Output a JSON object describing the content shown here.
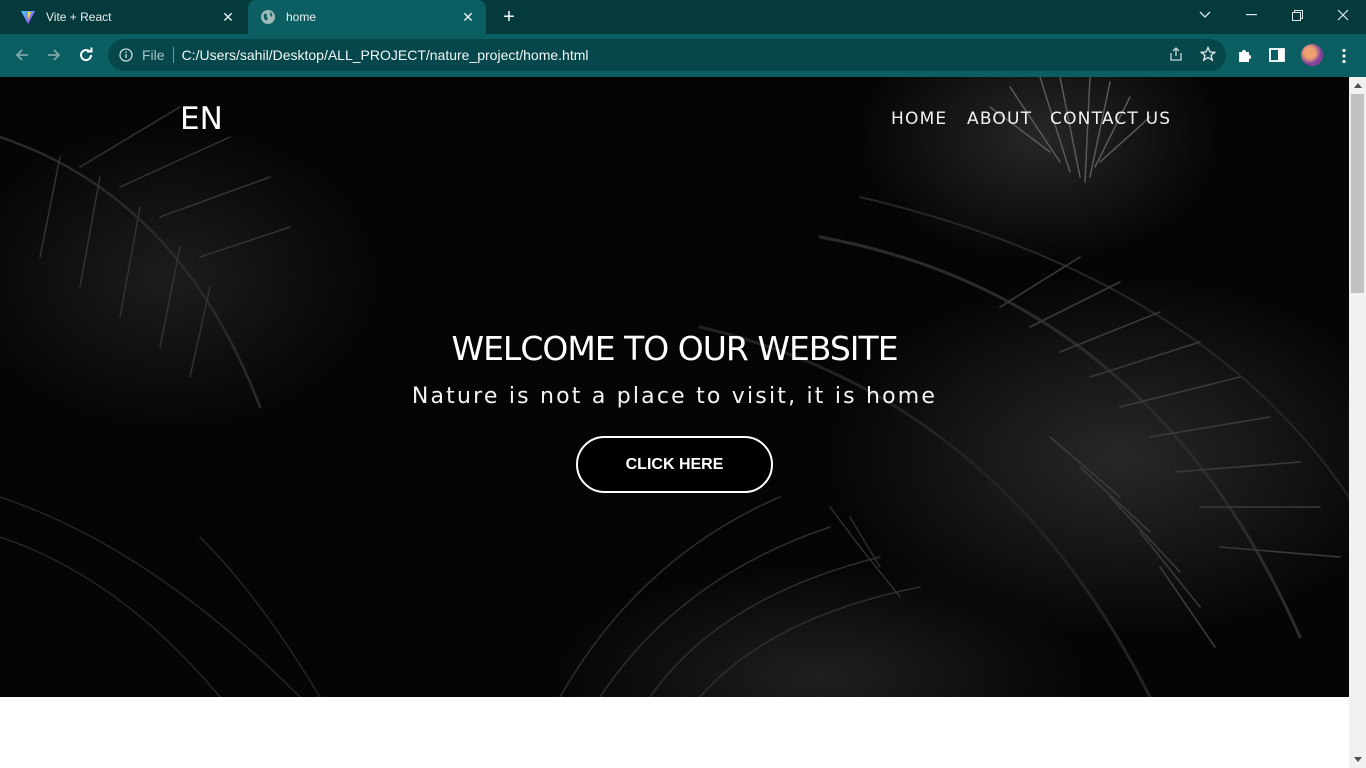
{
  "browser": {
    "tabs": [
      {
        "title": "Vite + React",
        "icon": "vite-icon",
        "active": false
      },
      {
        "title": "home",
        "icon": "globe-icon",
        "active": true
      }
    ],
    "address_scheme": "File",
    "address_url": "C:/Users/sahil/Desktop/ALL_PROJECT/nature_project/home.html"
  },
  "page": {
    "logo": "EN",
    "nav": {
      "home": "HOME",
      "about": "ABOUT",
      "contact": "CONTACT US"
    },
    "hero": {
      "title": "WELCOME TO OUR WEBSITE",
      "subtitle": "Nature is not a place to visit, it is home",
      "button": "CLICK HERE"
    }
  },
  "colors": {
    "tabbar_bg": "#053a3d",
    "toolbar_bg": "#0b5f63",
    "hero_bg": "#050505",
    "button_bg": "#000000",
    "button_border": "#ffffff"
  }
}
